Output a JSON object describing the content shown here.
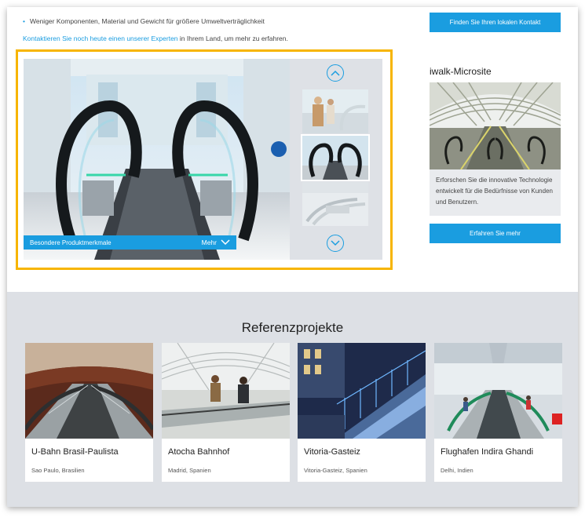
{
  "intro": {
    "bullet": "Weniger Komponenten, Material und Gewicht für größere Umweltverträglichkeit",
    "contact_link": "Kontaktieren Sie noch heute einen unserer Experten",
    "contact_rest": " in Ihrem Land, um mehr zu erfahren."
  },
  "gallery": {
    "caption": "Besondere Produktmerkmale",
    "more_label": "Mehr"
  },
  "side": {
    "contact_button": "Finden Sie Ihren lokalen Kontakt",
    "microsite_title": "iwalk-Microsite",
    "microsite_text": "Erforschen Sie die innovative Technologie entwickelt für die Bedürfnisse von Kunden und Benutzern.",
    "learn_more_button": "Erfahren Sie mehr"
  },
  "references": {
    "title": "Referenzprojekte",
    "items": [
      {
        "name": "U-Bahn Brasil-Paulista",
        "location": "Sao Paulo, Brasilien"
      },
      {
        "name": "Atocha Bahnhof",
        "location": "Madrid, Spanien"
      },
      {
        "name": "Vitoria-Gasteiz",
        "location": "Vitoria-Gasteiz, Spanien"
      },
      {
        "name": "Flughafen Indira Ghandi",
        "location": "Delhi, Indien"
      }
    ]
  },
  "colors": {
    "accent": "#1a9de0",
    "highlight_frame": "#f7b500",
    "section_bg": "#dde0e5"
  }
}
